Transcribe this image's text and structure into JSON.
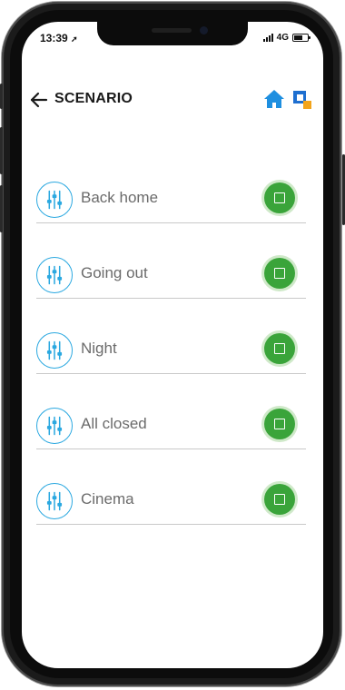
{
  "status_bar": {
    "time": "13:39",
    "network": "4G"
  },
  "header": {
    "title": "SCENARIO",
    "back_icon": "arrow-left-icon",
    "home_icon": "home-icon",
    "brand_icon": "brand-logo-icon"
  },
  "colors": {
    "accent_blue": "#2aa8e0",
    "stop_green": "#3aa43a",
    "stop_glow": "#cfe9c9",
    "brand_blue": "#1e6fd0",
    "brand_orange": "#f2a41c",
    "label_gray": "#6b6b6b"
  },
  "scenarios": [
    {
      "label": "Back home",
      "icon": "sliders-icon",
      "action_icon": "stop-icon"
    },
    {
      "label": "Going out",
      "icon": "sliders-icon",
      "action_icon": "stop-icon"
    },
    {
      "label": "Night",
      "icon": "sliders-icon",
      "action_icon": "stop-icon"
    },
    {
      "label": "All closed",
      "icon": "sliders-icon",
      "action_icon": "stop-icon"
    },
    {
      "label": "Cinema",
      "icon": "sliders-icon",
      "action_icon": "stop-icon"
    }
  ]
}
